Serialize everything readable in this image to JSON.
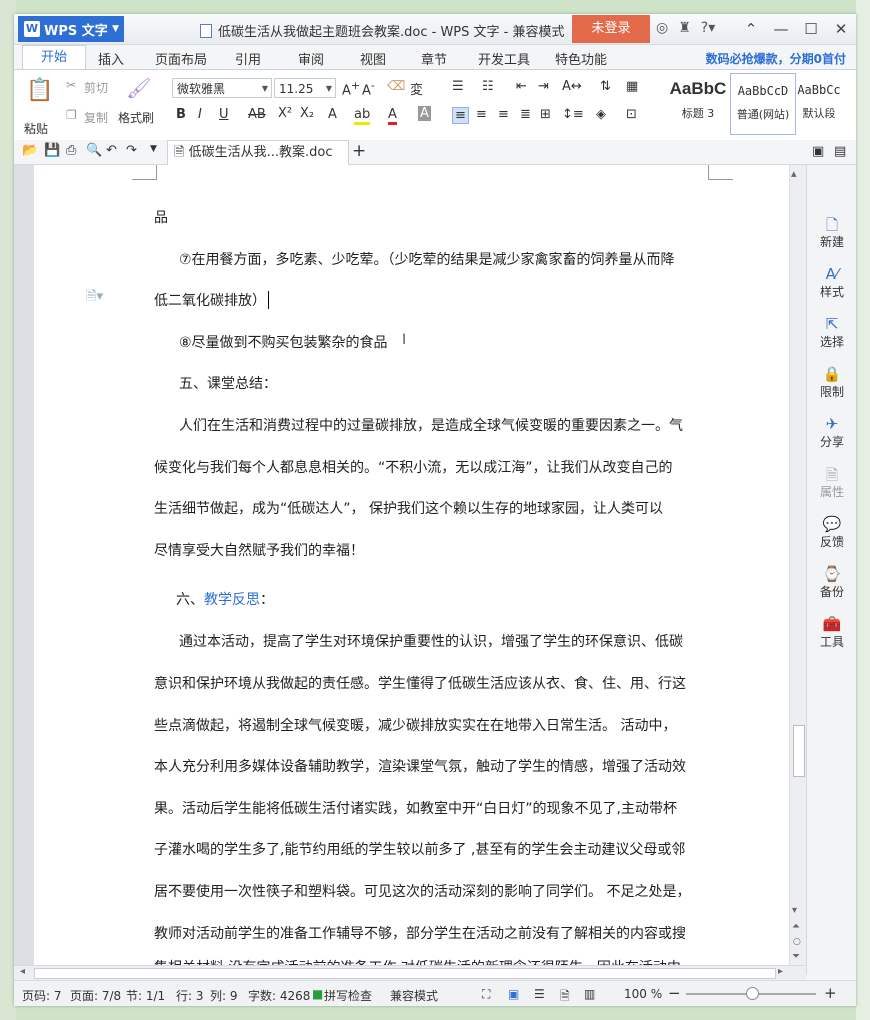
{
  "app": {
    "name": "WPS 文字",
    "title": "低碳生活从我做起主题班会教案.doc - WPS 文字 - 兼容模式",
    "login": "未登录"
  },
  "menu": {
    "tabs": [
      "开始",
      "插入",
      "页面布局",
      "引用",
      "审阅",
      "视图",
      "章节",
      "开发工具",
      "特色功能"
    ],
    "promo": "数码必抢爆款，分期0首付"
  },
  "ribbon": {
    "paste": "粘贴",
    "cut": "剪切",
    "copy": "复制",
    "format_painter": "格式刷",
    "font_name": "微软雅黑",
    "font_size": "11.25",
    "styles": [
      {
        "preview": "AaBbC",
        "label": "标题 3"
      },
      {
        "preview": "AaBbCcD",
        "label": "普通(网站)"
      },
      {
        "preview": "AaBbCc",
        "label": "默认段"
      }
    ]
  },
  "doctab": {
    "label": "低碳生活从我...教案.doc"
  },
  "document": {
    "lines": [
      "品",
      "⑦在用餐方面，多吃素、少吃荤。（少吃荤的结果是减少家禽家畜的饲养量从而降",
      "低二氧化碳排放）",
      "⑧尽量做到不购买包装繁杂的食品",
      "五、课堂总结：",
      "人们在生活和消费过程中的过量碳排放，是造成全球气候变暖的重要因素之一。气",
      "候变化与我们每个人都息息相关的。“不积小流，无以成江海”，让我们从改变自己的",
      "生活细节做起，成为“低碳达人”， 保护我们这个赖以生存的地球家园，让人类可以",
      "尽情享受大自然赋予我们的幸福！",
      "通过本活动，提高了学生对环境保护重要性的认识，增强了学生的环保意识、低碳",
      "意识和保护环境从我做起的责任感。学生懂得了低碳生活应该从衣、食、住、用、行这",
      "些点滴做起，将遏制全球气候变暖，减少碳排放实实在在地带入日常生活。    活动中，",
      "本人充分利用多媒体设备辅助教学，渲染课堂气氛，触动了学生的情感，增强了活动效",
      "果。活动后学生能将低碳生活付诸实践，如教室中开“白日灯”的现象不见了,主动带杯",
      "子灌水喝的学生多了,能节约用纸的学生较以前多了 ,甚至有的学生会主动建议父母或邻",
      "居不要使用一次性筷子和塑料袋。可见这次的活动深刻的影响了同学们。  不足之处是，",
      "教师对活动前学生的准备工作辅导不够，部分学生在活动之前没有了解相关的内容或搜",
      "集相关材料,没有完成活动前的准备工作,对低碳生活的新理念还很陌生。因此在活动中，"
    ],
    "heading6_prefix": "六、",
    "heading6_link": "教学反思",
    "heading6_suffix": "："
  },
  "sidepanel": [
    "新建",
    "样式",
    "选择",
    "限制",
    "分享",
    "属性",
    "反馈",
    "备份",
    "工具"
  ],
  "status": {
    "page": "页码: 7",
    "pages": "页面: 7/8",
    "section": "节: 1/1",
    "row": "行: 3",
    "col": "列: 9",
    "words": "字数: 4268",
    "spell": "拼写检查",
    "mode": "兼容模式",
    "zoom": "100 %"
  }
}
